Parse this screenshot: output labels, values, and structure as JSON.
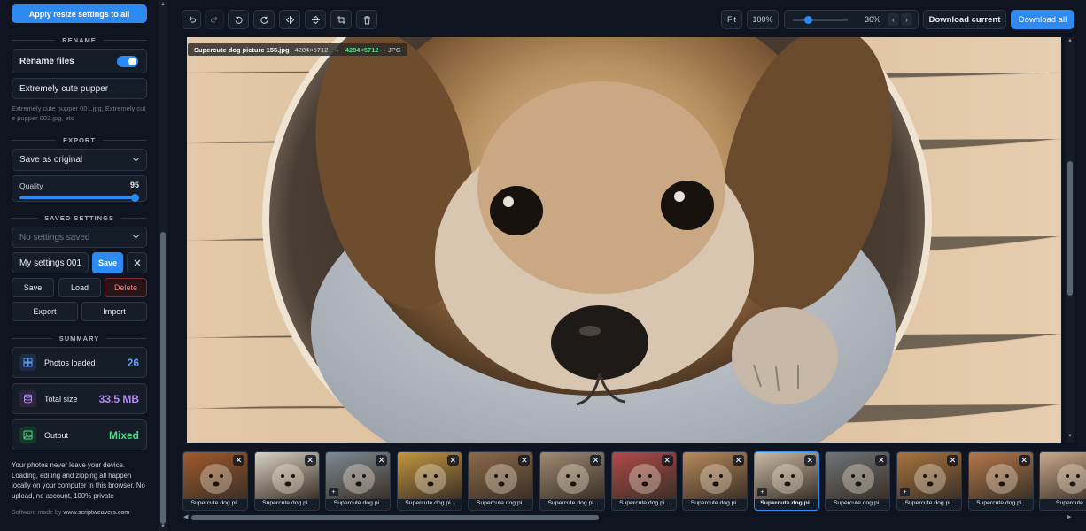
{
  "sidebar": {
    "apply_button": "Apply resize settings to all",
    "rename": {
      "heading": "RENAME",
      "toggle_label": "Rename files",
      "toggle_on": true,
      "name_value": "Extremely cute pupper",
      "hint": "Extremely cute pupper 001.jpg, Extremely cute pupper 002.jpg, etc"
    },
    "export": {
      "heading": "EXPORT",
      "format_value": "Save as original",
      "quality_label": "Quality",
      "quality_value": "95"
    },
    "saved_settings": {
      "heading": "SAVED SETTINGS",
      "select_placeholder": "No settings saved",
      "name_value": "My settings 001",
      "save_inline": "Save",
      "clear_icon": "close-icon",
      "buttons": [
        "Save",
        "Load",
        "Delete",
        "Export",
        "Import"
      ]
    },
    "summary": {
      "heading": "SUMMARY",
      "photos_label": "Photos loaded",
      "photos_value": "26",
      "size_label": "Total size",
      "size_value": "33.5 MB",
      "output_label": "Output",
      "output_value": "Mixed"
    },
    "privacy_note": "Your photos never leave your device. Loading, editing and zipping all happen locally on your computer in this browser. No upload, no account, 100% private",
    "credit_prefix": "Software made by",
    "credit_link": "www.scriptweavers.com"
  },
  "toolbar": {
    "icons": [
      "undo-icon",
      "redo-icon",
      "rotate-left-icon",
      "rotate-right-icon",
      "flip-horizontal-icon",
      "flip-vertical-icon",
      "crop-icon",
      "trash-icon"
    ],
    "fit_label": "Fit",
    "zoom_100_label": "100%",
    "zoom_value": "36%",
    "zoom_fraction": 0.28,
    "download_current": "Download current",
    "download_all": "Download all"
  },
  "preview": {
    "filename": "Supercute dog picture 155.jpg",
    "dimensions": "4284×5712",
    "arrow": "→",
    "new_dimensions": "4284×5712",
    "format": "· JPG"
  },
  "thumbnails": [
    {
      "caption": "Supercute dog pi...",
      "has_marker": false,
      "selected": false,
      "tone": "#a0592b"
    },
    {
      "caption": "Supercute dog pi...",
      "has_marker": false,
      "selected": false,
      "tone": "#d8d2c4"
    },
    {
      "caption": "Supercute dog pi...",
      "has_marker": true,
      "selected": false,
      "tone": "#7d8a93"
    },
    {
      "caption": "Supercute dog pi...",
      "has_marker": false,
      "selected": false,
      "tone": "#c4963e"
    },
    {
      "caption": "Supercute dog pi...",
      "has_marker": false,
      "selected": false,
      "tone": "#8b6a4a"
    },
    {
      "caption": "Supercute dog pi...",
      "has_marker": false,
      "selected": false,
      "tone": "#9e8a73"
    },
    {
      "caption": "Supercute dog pi...",
      "has_marker": false,
      "selected": false,
      "tone": "#b04a4a"
    },
    {
      "caption": "Supercute dog pi...",
      "has_marker": false,
      "selected": false,
      "tone": "#b88a5a"
    },
    {
      "caption": "Supercute dog pi...",
      "has_marker": true,
      "selected": true,
      "tone": "#c9b9a6"
    },
    {
      "caption": "Supercute dog pi...",
      "has_marker": false,
      "selected": false,
      "tone": "#6f7378"
    },
    {
      "caption": "Supercute dog pi...",
      "has_marker": true,
      "selected": false,
      "tone": "#a8743e"
    },
    {
      "caption": "Supercute dog pi...",
      "has_marker": false,
      "selected": false,
      "tone": "#b4784a"
    },
    {
      "caption": "Supercute ...",
      "has_marker": false,
      "selected": false,
      "tone": "#c9a88a"
    }
  ]
}
